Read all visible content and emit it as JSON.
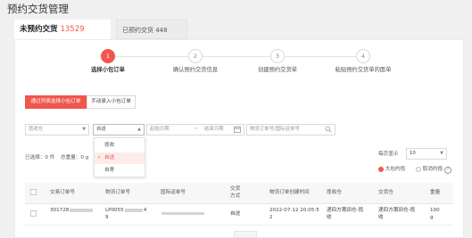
{
  "page": {
    "title": "预约交货管理"
  },
  "tabs": [
    {
      "label": "未预约交货",
      "count": "13529"
    },
    {
      "label": "已预约交货 448"
    }
  ],
  "steps": [
    {
      "num": "1",
      "label": "选择小包订单"
    },
    {
      "num": "2",
      "label": "确认预约交货信息"
    },
    {
      "num": "3",
      "label": "创建预约交货单"
    },
    {
      "num": "4",
      "label": "粘贴预约交货单的面单"
    }
  ],
  "buttons": {
    "select_from_list": "通过列表选择小包订单",
    "manual_input": "手动录入小包订单"
  },
  "filters": {
    "warehouse_placeholder": "揽收仓",
    "type_value": "自送",
    "start_date": "起始日期",
    "to_sep": "~",
    "end_date": "结束日期",
    "order_search": "物流订单号/国际运单号"
  },
  "dropdown": {
    "options": [
      "揽收",
      "自送",
      "自寄"
    ],
    "selected_index": 1
  },
  "summary": {
    "selected_label": "已选择：0 件",
    "total_weight_label": "总重量：0 g"
  },
  "pagination": {
    "per_page_label": "每页显示",
    "per_page_value": "10"
  },
  "package_type": {
    "options": [
      "大包约揽",
      "取消约揽"
    ],
    "selected_index": 0,
    "help_icon_glyph": "?"
  },
  "table": {
    "headers": [
      "交易订单号",
      "物流订单号",
      "国际运单号",
      "交货方式",
      "物流订单创建时间",
      "揽收仓",
      "交货仓",
      "重量"
    ],
    "rows": [
      {
        "trade_order_prefix": "301728",
        "logistics_order_prefix": "LP0055",
        "logistics_order_suffix_1": "4",
        "logistics_order_suffix_2": "9",
        "delivery_method": "自送",
        "created_time_1": "2022-07-12 20:05:5",
        "created_time_2": "2",
        "pickup_warehouse_1": "递四方莆田仓-揽",
        "pickup_warehouse_2": "收",
        "delivery_warehouse_1": "递四方莆田仓-揽",
        "delivery_warehouse_2": "收",
        "weight_1": "100",
        "weight_2": "g"
      }
    ]
  },
  "colors": {
    "accent": "#f0564d",
    "border": "#d9d9d9",
    "page_bg": "#f0f0f0"
  },
  "icons": [
    "calendar-icon",
    "search-icon",
    "chevron-down-icon",
    "check-icon",
    "help-icon"
  ]
}
